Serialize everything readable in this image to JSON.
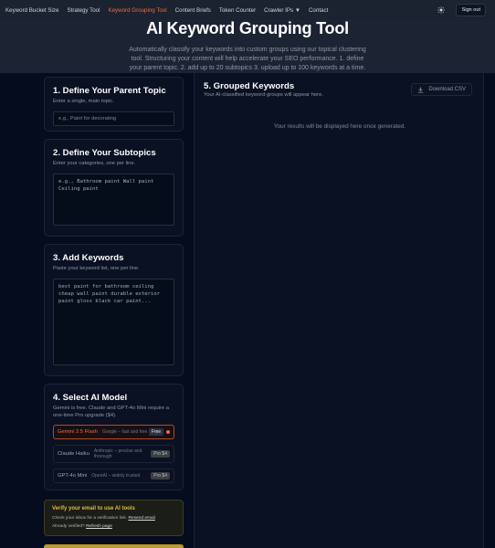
{
  "nav": {
    "items": [
      {
        "label": "Keyword Bucket Size",
        "active": false
      },
      {
        "label": "Strategy Tool",
        "active": false
      },
      {
        "label": "Keyword Grouping Tool",
        "active": true
      },
      {
        "label": "Content Briefs",
        "active": false
      },
      {
        "label": "Token Counter",
        "active": false
      },
      {
        "label": "Crawler IPs ▼",
        "active": false
      },
      {
        "label": "Contact",
        "active": false
      }
    ],
    "theme_icon": "sun-icon",
    "signout_label": "Sign out"
  },
  "hero": {
    "title": "AI Keyword Grouping Tool",
    "description": "Automatically classify your keywords into custom groups using our topical clustering tool. Structuring your content will help accelerate your SEO performance. 1. define your parent topic. 2. add up to 20 subtopics 3. upload up to 100 keywords at a time."
  },
  "step1": {
    "title": "1. Define Your Parent Topic",
    "subtitle": "Enter a single, main topic.",
    "placeholder": "e.g., Paint for decorating"
  },
  "step2": {
    "title": "2. Define Your Subtopics",
    "subtitle": "Enter your categories, one per line.",
    "placeholder": "e.g., Bathroom paint Wall paint Ceiling paint"
  },
  "step3": {
    "title": "3. Add Keywords",
    "subtitle": "Paste your keyword list, one per line.",
    "placeholder": "best paint for bathroom ceiling cheap wall paint durable exterior paint gloss black car paint..."
  },
  "step4": {
    "title": "4. Select AI Model",
    "subtitle": "Gemini is free. Claude and GPT-4o Mini require a one-time Pro upgrade ($4).",
    "models": [
      {
        "name": "Gemini 2.5 Flash",
        "desc": "Google – fast and free",
        "tag": "Free",
        "selected": true
      },
      {
        "name": "Claude Haiku",
        "desc": "Anthropic – precise and thorough",
        "tag": "Pro $4",
        "selected": false
      },
      {
        "name": "GPT-4o Mini",
        "desc": "OpenAI – widely trusted",
        "tag": "Pro $4",
        "selected": false
      }
    ]
  },
  "verify": {
    "title": "Verify your email to use AI tools",
    "line1": "Check your inbox for a verification link.",
    "resend_label": "Resend email",
    "line2": "Already verified?",
    "refresh_label": "Refresh page"
  },
  "results": {
    "title": "5. Grouped Keywords",
    "subtitle": "Your AI-classified keyword groups will appear here.",
    "download_label": "Download CSV",
    "download_icon": "download-icon",
    "empty_message": "Your results will be displayed here once generated."
  },
  "colors": {
    "accent": "#f26b3a",
    "background": "#050c1d",
    "warning": "#e7b93d"
  }
}
